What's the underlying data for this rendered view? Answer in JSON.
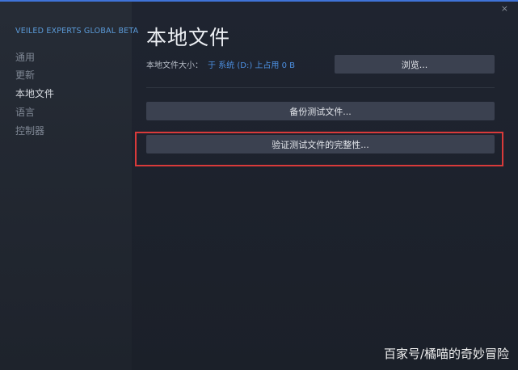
{
  "sidebar": {
    "game_title": "VEILED EXPERTS GLOBAL BETA",
    "items": [
      {
        "label": "通用"
      },
      {
        "label": "更新"
      },
      {
        "label": "本地文件"
      },
      {
        "label": "语言"
      },
      {
        "label": "控制器"
      }
    ],
    "active_index": 2
  },
  "main": {
    "title": "本地文件",
    "size_label": "本地文件大小：",
    "size_value": "于 系统 (D:) 上占用 0 B",
    "browse_button": "浏览...",
    "backup_button": "备份测试文件...",
    "verify_button": "验证测试文件的完整性..."
  },
  "window": {
    "close_icon": "×"
  },
  "watermark": "百家号/橘喵的奇妙冒险",
  "colors": {
    "accent": "#3f73d8",
    "link": "#4c8fe0",
    "highlight_box": "#d93a3a"
  }
}
